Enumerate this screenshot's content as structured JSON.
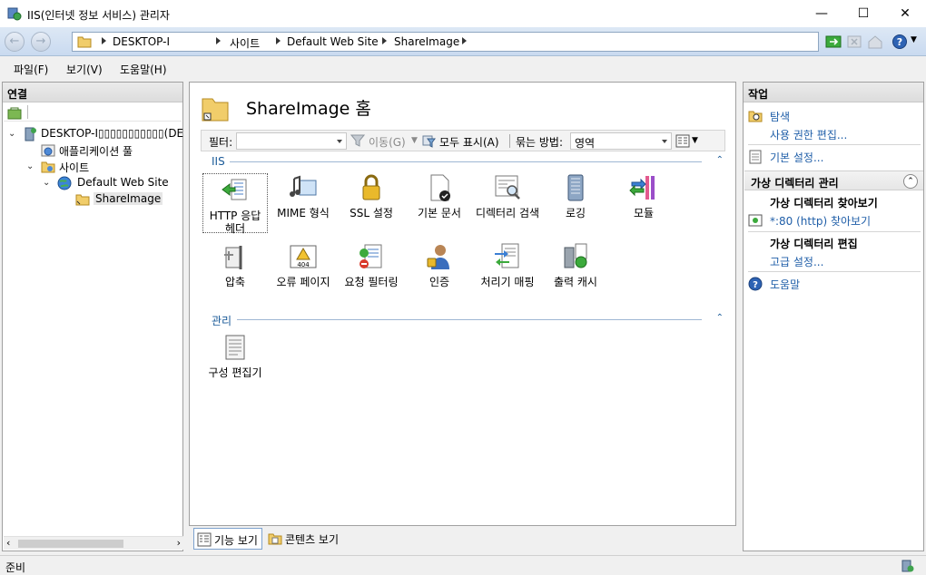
{
  "window": {
    "title": "IIS(인터넷 정보 서비스) 관리자",
    "minimize": "—",
    "maximize": "☐",
    "close": "✕"
  },
  "address": {
    "crumbs": [
      "DESKTOP-I",
      "사이트",
      "Default Web Site",
      "ShareImage"
    ]
  },
  "menu": [
    "파일(F)",
    "보기(V)",
    "도움말(H)"
  ],
  "connections": {
    "title": "연결",
    "tree": [
      {
        "label": "DESKTOP-I▯▯▯▯▯▯▯▯▯▯▯(DESKTOP",
        "icon": "server-icon"
      },
      {
        "label": "애플리케이션 풀",
        "icon": "app-pool-icon"
      },
      {
        "label": "사이트",
        "icon": "sites-folder-icon"
      },
      {
        "label": "Default Web Site",
        "icon": "globe-icon"
      },
      {
        "label": "ShareImage",
        "icon": "virtual-directory-icon"
      }
    ]
  },
  "center": {
    "title": "ShareImage 홈",
    "filter": {
      "label": "필터:",
      "value": "",
      "go": "이동(G)",
      "show_all": "모두 표시(A)",
      "group_by_label": "묶는 방법:",
      "group_by_value": "영역"
    },
    "groups": [
      {
        "name": "IIS",
        "features": [
          {
            "label": "HTTP 응답 헤더",
            "icon": "http-response-headers-icon"
          },
          {
            "label": "MIME 형식",
            "icon": "mime-types-icon"
          },
          {
            "label": "SSL 설정",
            "icon": "ssl-lock-icon"
          },
          {
            "label": "기본 문서",
            "icon": "default-document-icon"
          },
          {
            "label": "디렉터리 검색",
            "icon": "directory-browsing-icon"
          },
          {
            "label": "로깅",
            "icon": "logging-icon"
          },
          {
            "label": "모듈",
            "icon": "modules-icon"
          },
          {
            "label": "압축",
            "icon": "compression-icon"
          },
          {
            "label": "오류 페이지",
            "icon": "error-pages-icon"
          },
          {
            "label": "요청 필터링",
            "icon": "request-filtering-icon"
          },
          {
            "label": "인증",
            "icon": "authentication-icon"
          },
          {
            "label": "처리기 매핑",
            "icon": "handler-mappings-icon"
          },
          {
            "label": "출력 캐시",
            "icon": "output-cache-icon"
          }
        ]
      },
      {
        "name": "관리",
        "features": [
          {
            "label": "구성 편집기",
            "icon": "configuration-editor-icon"
          }
        ]
      }
    ],
    "views": {
      "features": "기능 보기",
      "content": "콘텐츠 보기"
    }
  },
  "actions": {
    "title": "작업",
    "explore": "탐색",
    "edit_permissions": "사용 권한 편집...",
    "basic_settings": "기본 설정...",
    "manage_vdir": "가상 디렉터리 관리",
    "browse_vdir": "가상 디렉터리 찾아보기",
    "browse_link": "*:80 (http) 찾아보기",
    "edit_vdir": "가상 디렉터리 편집",
    "advanced": "고급 설정...",
    "help": "도움말"
  },
  "status": "준비"
}
